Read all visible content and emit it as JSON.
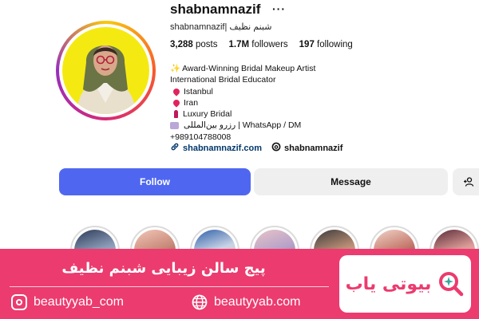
{
  "profile": {
    "username": "shabnamnazif",
    "more_icon": "more-horizontal-icon",
    "full_name": "shabnamnazif| شبنم نظیف",
    "stats": {
      "posts_count": "3,288",
      "posts_label": "posts",
      "followers_count": "1.7M",
      "followers_label": "followers",
      "following_count": "197",
      "following_label": "following"
    },
    "bio": {
      "line1": "Award-Winning Bridal Makeup Artist",
      "line2": "International Bridal Educator",
      "line3": "Istanbul",
      "line4": "Iran",
      "line5": "Luxury Bridal",
      "line6": "رزرو بین‌المللی | WhatsApp / DM",
      "line7": "+989104788008"
    },
    "website": "shabnamnazif.com",
    "threads_handle": "shabnamnazif"
  },
  "actions": {
    "follow_label": "Follow",
    "message_label": "Message",
    "suggest_icon": "add-person-icon"
  },
  "highlights_count": 7,
  "banner": {
    "title": "پیج سالن زیبایی شبنم نظیف",
    "instagram_handle": "beautyyab_com",
    "website": "beautyyab.com",
    "logo_text": "بیوتی یاب"
  },
  "colors": {
    "follow_button": "#4f67f0",
    "banner": "#ec3b6e",
    "avatar_background": "#f4ea12"
  }
}
